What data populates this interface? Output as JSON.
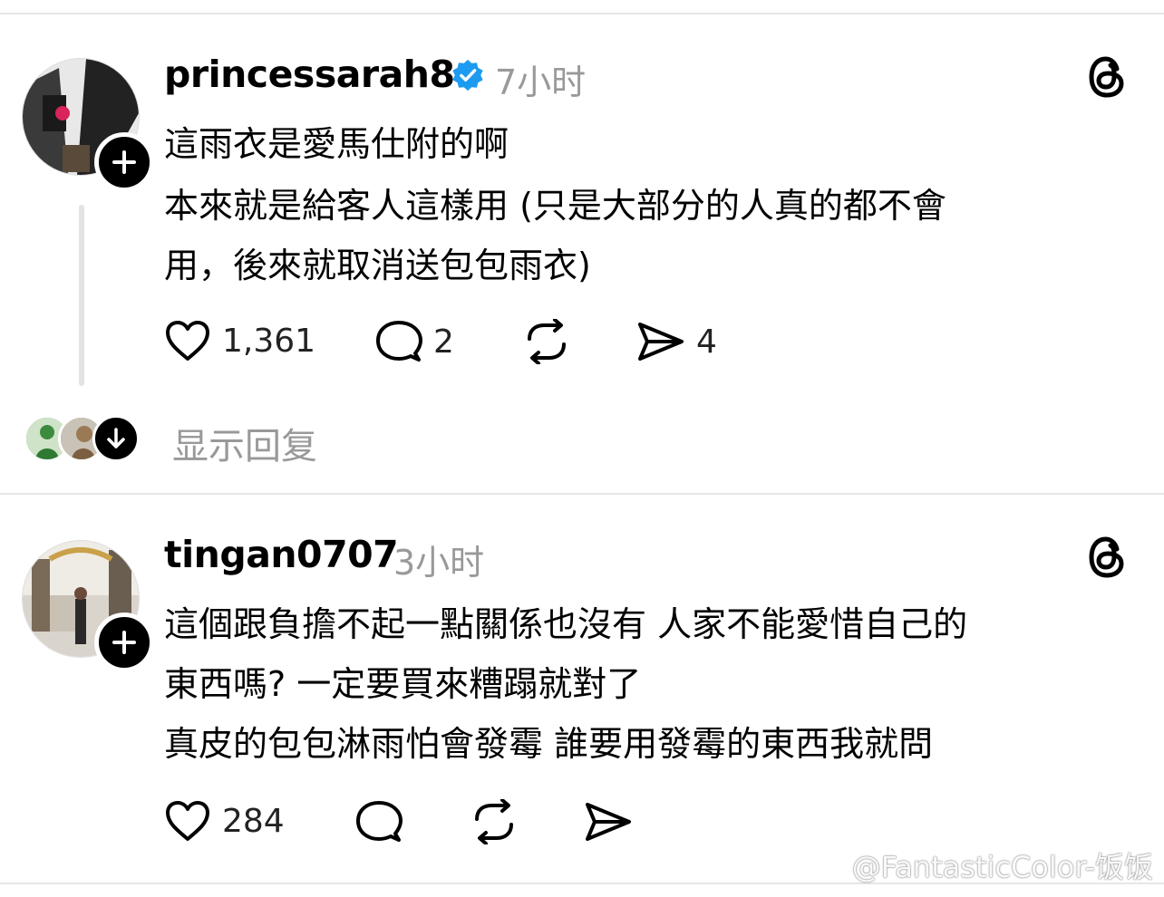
{
  "posts": [
    {
      "username": "princessarah8",
      "verified": true,
      "time": "7小时",
      "lines": [
        "這雨衣是愛馬仕附的啊",
        "本來就是給客人這樣用 (只是大部分的人真的都不會",
        "用，後來就取消送包包雨衣)"
      ],
      "likes": "1,361",
      "comments": "2",
      "reposts": "",
      "shares": "4",
      "show_replies": "显示回复"
    },
    {
      "username": "tingan0707",
      "verified": false,
      "time": "3小时",
      "lines": [
        "這個跟負擔不起一點關係也沒有 人家不能愛惜自己的",
        "東西嗎? 一定要買來糟蹋就對了",
        "真皮的包包淋雨怕會發霉 誰要用發霉的東西我就問"
      ],
      "likes": "284",
      "comments": "",
      "reposts": "",
      "shares": ""
    }
  ],
  "icons": {
    "verified": "verified-badge-icon",
    "threads": "threads-logo-icon",
    "like": "heart-icon",
    "comment": "comment-icon",
    "repost": "repost-icon",
    "share": "send-icon",
    "follow": "plus-icon",
    "expand": "arrow-down-icon"
  },
  "colors": {
    "verified": "#1d9bf0",
    "muted": "#999999",
    "divider": "#e6e6e6"
  },
  "watermark": "@FantasticColor-饭饭"
}
